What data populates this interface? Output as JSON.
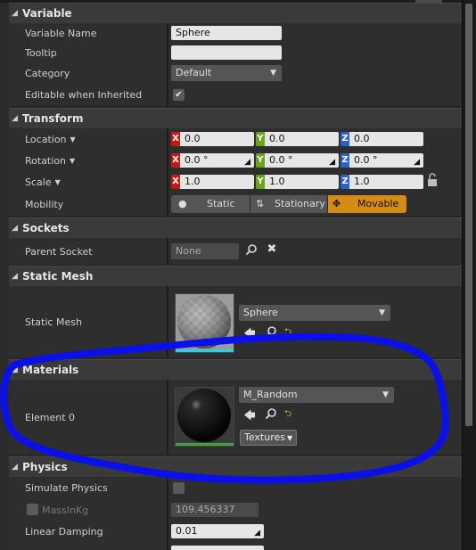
{
  "sections": {
    "variable": "Variable",
    "transform": "Transform",
    "sockets": "Sockets",
    "static_mesh": "Static Mesh",
    "materials": "Materials",
    "physics": "Physics"
  },
  "variable": {
    "name_label": "Variable Name",
    "name_value": "Sphere",
    "tooltip_label": "Tooltip",
    "tooltip_value": "",
    "category_label": "Category",
    "category_value": "Default",
    "editable_label": "Editable when Inherited",
    "editable_checked": true
  },
  "transform": {
    "location": {
      "label": "Location",
      "x": "0.0",
      "y": "0.0",
      "z": "0.0"
    },
    "rotation": {
      "label": "Rotation",
      "x": "0.0 °",
      "y": "0.0 °",
      "z": "0.0 °"
    },
    "scale": {
      "label": "Scale",
      "x": "1.0",
      "y": "1.0",
      "z": "1.0"
    },
    "mobility_label": "Mobility",
    "mobility_options": [
      "Static",
      "Stationary",
      "Movable"
    ],
    "mobility_selected": "Movable",
    "axis": {
      "x": "X",
      "y": "Y",
      "z": "Z"
    }
  },
  "sockets": {
    "parent_label": "Parent Socket",
    "parent_value": "None"
  },
  "static_mesh": {
    "label": "Static Mesh",
    "asset": "Sphere"
  },
  "materials": {
    "element_label": "Element 0",
    "asset": "M_Random",
    "textures_button": "Textures"
  },
  "physics": {
    "simulate_label": "Simulate Physics",
    "simulate_checked": false,
    "mass_label": "MassInKg",
    "mass_value": "109.456337",
    "linear_damping_label": "Linear Damping",
    "linear_damping_value": "0.01"
  },
  "colors": {
    "panel_bg": "#2b2b2b",
    "header_bg": "#3a3a3a",
    "movable_accent": "#d58c16",
    "axis_x": "#c21b12",
    "axis_y": "#6aa41b",
    "axis_z": "#2d61c8",
    "annotation_stroke": "#0a10e8"
  }
}
